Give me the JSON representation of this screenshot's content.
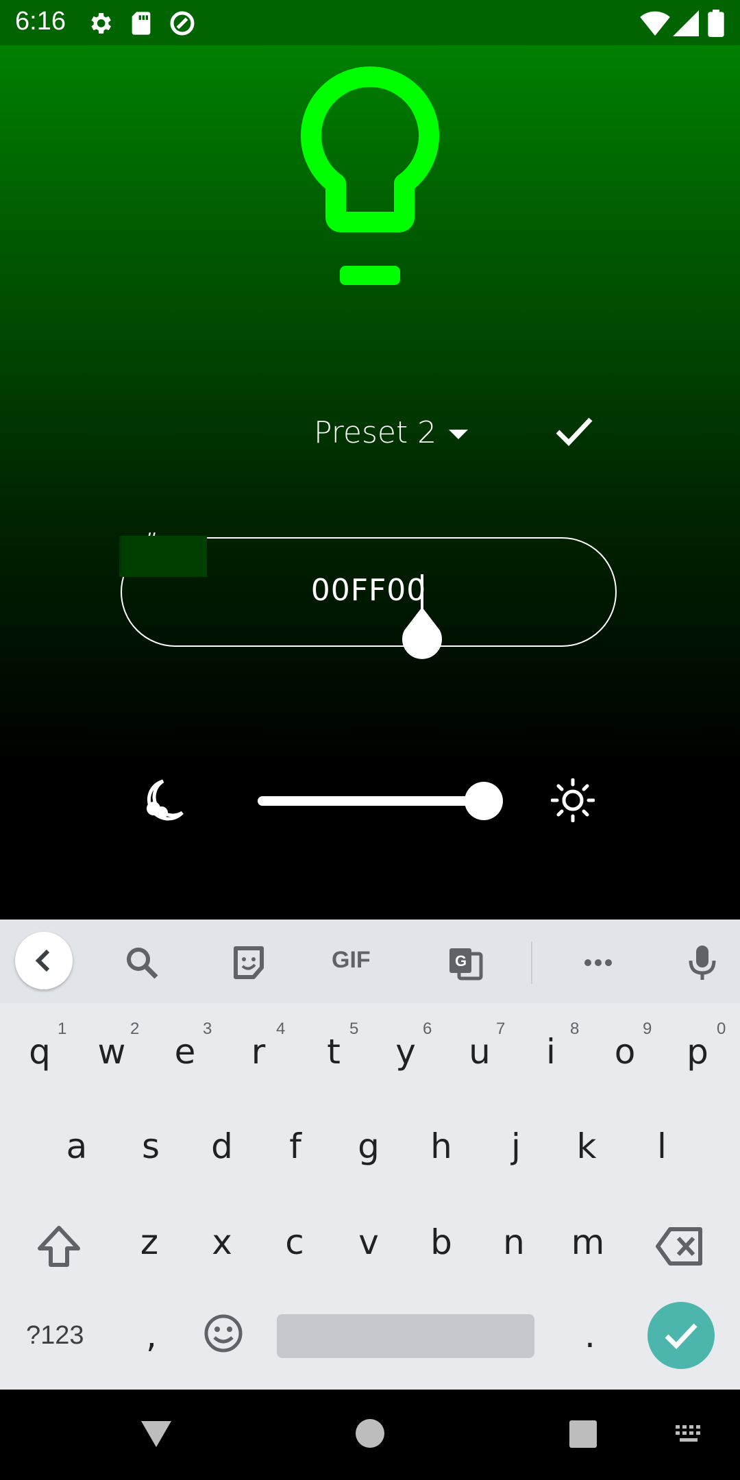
{
  "status_bar": {
    "time": "6:16",
    "icons": [
      "settings-icon",
      "sd-card-icon",
      "data-saver-icon",
      "wifi-icon",
      "signal-icon",
      "battery-icon"
    ],
    "background": "#006400"
  },
  "app": {
    "bulb_color": "#00ff00",
    "preset_label": "Preset 2",
    "hex_prefix": "#",
    "hex_value": "00FF00",
    "brightness": 1.0
  },
  "keyboard": {
    "toolbar": {
      "gif_label": "GIF",
      "icons": [
        "back-icon",
        "search-icon",
        "sticker-icon",
        "gif-icon",
        "translate-icon",
        "more-icon",
        "mic-icon"
      ]
    },
    "row1": [
      "q",
      "w",
      "e",
      "r",
      "t",
      "y",
      "u",
      "i",
      "o",
      "p"
    ],
    "row1_hints": [
      "1",
      "2",
      "3",
      "4",
      "5",
      "6",
      "7",
      "8",
      "9",
      "0"
    ],
    "row2": [
      "a",
      "s",
      "d",
      "f",
      "g",
      "h",
      "j",
      "k",
      "l"
    ],
    "row3": [
      "z",
      "x",
      "c",
      "v",
      "b",
      "n",
      "m"
    ],
    "symbols_label": "?123",
    "comma": ",",
    "period": ".",
    "enter_color": "#4db6ac"
  },
  "nav": {
    "icons": [
      "back-triangle-icon",
      "home-circle-icon",
      "recents-square-icon",
      "keyboard-switch-icon"
    ]
  }
}
